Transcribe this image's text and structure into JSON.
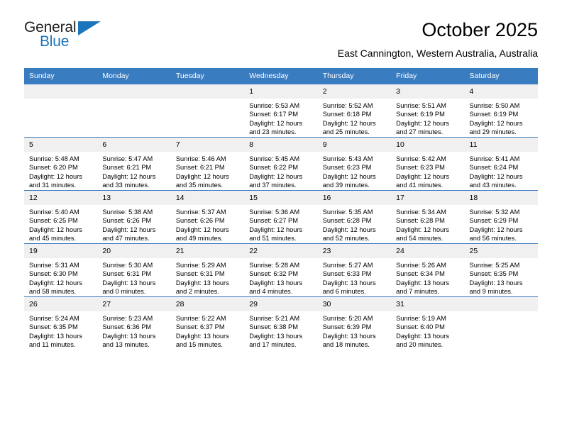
{
  "brand": {
    "name_part1": "General",
    "name_part2": "Blue",
    "accent_color": "#1b75bc",
    "logo_icon": "triangle-flag-icon"
  },
  "header": {
    "title": "October 2025",
    "subtitle": "East Cannington, Western Australia, Australia"
  },
  "calendar": {
    "header_bg": "#3a7cc0",
    "daynum_bg": "#f0f0f0",
    "weekday_headers": [
      "Sunday",
      "Monday",
      "Tuesday",
      "Wednesday",
      "Thursday",
      "Friday",
      "Saturday"
    ],
    "labels": {
      "sunrise": "Sunrise:",
      "sunset": "Sunset:",
      "daylight": "Daylight:"
    },
    "weeks": [
      [
        {
          "day": "",
          "sunrise": "",
          "sunset": "",
          "daylight": ""
        },
        {
          "day": "",
          "sunrise": "",
          "sunset": "",
          "daylight": ""
        },
        {
          "day": "",
          "sunrise": "",
          "sunset": "",
          "daylight": ""
        },
        {
          "day": "1",
          "sunrise": "Sunrise: 5:53 AM",
          "sunset": "Sunset: 6:17 PM",
          "daylight": "Daylight: 12 hours and 23 minutes."
        },
        {
          "day": "2",
          "sunrise": "Sunrise: 5:52 AM",
          "sunset": "Sunset: 6:18 PM",
          "daylight": "Daylight: 12 hours and 25 minutes."
        },
        {
          "day": "3",
          "sunrise": "Sunrise: 5:51 AM",
          "sunset": "Sunset: 6:19 PM",
          "daylight": "Daylight: 12 hours and 27 minutes."
        },
        {
          "day": "4",
          "sunrise": "Sunrise: 5:50 AM",
          "sunset": "Sunset: 6:19 PM",
          "daylight": "Daylight: 12 hours and 29 minutes."
        }
      ],
      [
        {
          "day": "5",
          "sunrise": "Sunrise: 5:48 AM",
          "sunset": "Sunset: 6:20 PM",
          "daylight": "Daylight: 12 hours and 31 minutes."
        },
        {
          "day": "6",
          "sunrise": "Sunrise: 5:47 AM",
          "sunset": "Sunset: 6:21 PM",
          "daylight": "Daylight: 12 hours and 33 minutes."
        },
        {
          "day": "7",
          "sunrise": "Sunrise: 5:46 AM",
          "sunset": "Sunset: 6:21 PM",
          "daylight": "Daylight: 12 hours and 35 minutes."
        },
        {
          "day": "8",
          "sunrise": "Sunrise: 5:45 AM",
          "sunset": "Sunset: 6:22 PM",
          "daylight": "Daylight: 12 hours and 37 minutes."
        },
        {
          "day": "9",
          "sunrise": "Sunrise: 5:43 AM",
          "sunset": "Sunset: 6:23 PM",
          "daylight": "Daylight: 12 hours and 39 minutes."
        },
        {
          "day": "10",
          "sunrise": "Sunrise: 5:42 AM",
          "sunset": "Sunset: 6:23 PM",
          "daylight": "Daylight: 12 hours and 41 minutes."
        },
        {
          "day": "11",
          "sunrise": "Sunrise: 5:41 AM",
          "sunset": "Sunset: 6:24 PM",
          "daylight": "Daylight: 12 hours and 43 minutes."
        }
      ],
      [
        {
          "day": "12",
          "sunrise": "Sunrise: 5:40 AM",
          "sunset": "Sunset: 6:25 PM",
          "daylight": "Daylight: 12 hours and 45 minutes."
        },
        {
          "day": "13",
          "sunrise": "Sunrise: 5:38 AM",
          "sunset": "Sunset: 6:26 PM",
          "daylight": "Daylight: 12 hours and 47 minutes."
        },
        {
          "day": "14",
          "sunrise": "Sunrise: 5:37 AM",
          "sunset": "Sunset: 6:26 PM",
          "daylight": "Daylight: 12 hours and 49 minutes."
        },
        {
          "day": "15",
          "sunrise": "Sunrise: 5:36 AM",
          "sunset": "Sunset: 6:27 PM",
          "daylight": "Daylight: 12 hours and 51 minutes."
        },
        {
          "day": "16",
          "sunrise": "Sunrise: 5:35 AM",
          "sunset": "Sunset: 6:28 PM",
          "daylight": "Daylight: 12 hours and 52 minutes."
        },
        {
          "day": "17",
          "sunrise": "Sunrise: 5:34 AM",
          "sunset": "Sunset: 6:28 PM",
          "daylight": "Daylight: 12 hours and 54 minutes."
        },
        {
          "day": "18",
          "sunrise": "Sunrise: 5:32 AM",
          "sunset": "Sunset: 6:29 PM",
          "daylight": "Daylight: 12 hours and 56 minutes."
        }
      ],
      [
        {
          "day": "19",
          "sunrise": "Sunrise: 5:31 AM",
          "sunset": "Sunset: 6:30 PM",
          "daylight": "Daylight: 12 hours and 58 minutes."
        },
        {
          "day": "20",
          "sunrise": "Sunrise: 5:30 AM",
          "sunset": "Sunset: 6:31 PM",
          "daylight": "Daylight: 13 hours and 0 minutes."
        },
        {
          "day": "21",
          "sunrise": "Sunrise: 5:29 AM",
          "sunset": "Sunset: 6:31 PM",
          "daylight": "Daylight: 13 hours and 2 minutes."
        },
        {
          "day": "22",
          "sunrise": "Sunrise: 5:28 AM",
          "sunset": "Sunset: 6:32 PM",
          "daylight": "Daylight: 13 hours and 4 minutes."
        },
        {
          "day": "23",
          "sunrise": "Sunrise: 5:27 AM",
          "sunset": "Sunset: 6:33 PM",
          "daylight": "Daylight: 13 hours and 6 minutes."
        },
        {
          "day": "24",
          "sunrise": "Sunrise: 5:26 AM",
          "sunset": "Sunset: 6:34 PM",
          "daylight": "Daylight: 13 hours and 7 minutes."
        },
        {
          "day": "25",
          "sunrise": "Sunrise: 5:25 AM",
          "sunset": "Sunset: 6:35 PM",
          "daylight": "Daylight: 13 hours and 9 minutes."
        }
      ],
      [
        {
          "day": "26",
          "sunrise": "Sunrise: 5:24 AM",
          "sunset": "Sunset: 6:35 PM",
          "daylight": "Daylight: 13 hours and 11 minutes."
        },
        {
          "day": "27",
          "sunrise": "Sunrise: 5:23 AM",
          "sunset": "Sunset: 6:36 PM",
          "daylight": "Daylight: 13 hours and 13 minutes."
        },
        {
          "day": "28",
          "sunrise": "Sunrise: 5:22 AM",
          "sunset": "Sunset: 6:37 PM",
          "daylight": "Daylight: 13 hours and 15 minutes."
        },
        {
          "day": "29",
          "sunrise": "Sunrise: 5:21 AM",
          "sunset": "Sunset: 6:38 PM",
          "daylight": "Daylight: 13 hours and 17 minutes."
        },
        {
          "day": "30",
          "sunrise": "Sunrise: 5:20 AM",
          "sunset": "Sunset: 6:39 PM",
          "daylight": "Daylight: 13 hours and 18 minutes."
        },
        {
          "day": "31",
          "sunrise": "Sunrise: 5:19 AM",
          "sunset": "Sunset: 6:40 PM",
          "daylight": "Daylight: 13 hours and 20 minutes."
        },
        {
          "day": "",
          "sunrise": "",
          "sunset": "",
          "daylight": ""
        }
      ]
    ]
  }
}
